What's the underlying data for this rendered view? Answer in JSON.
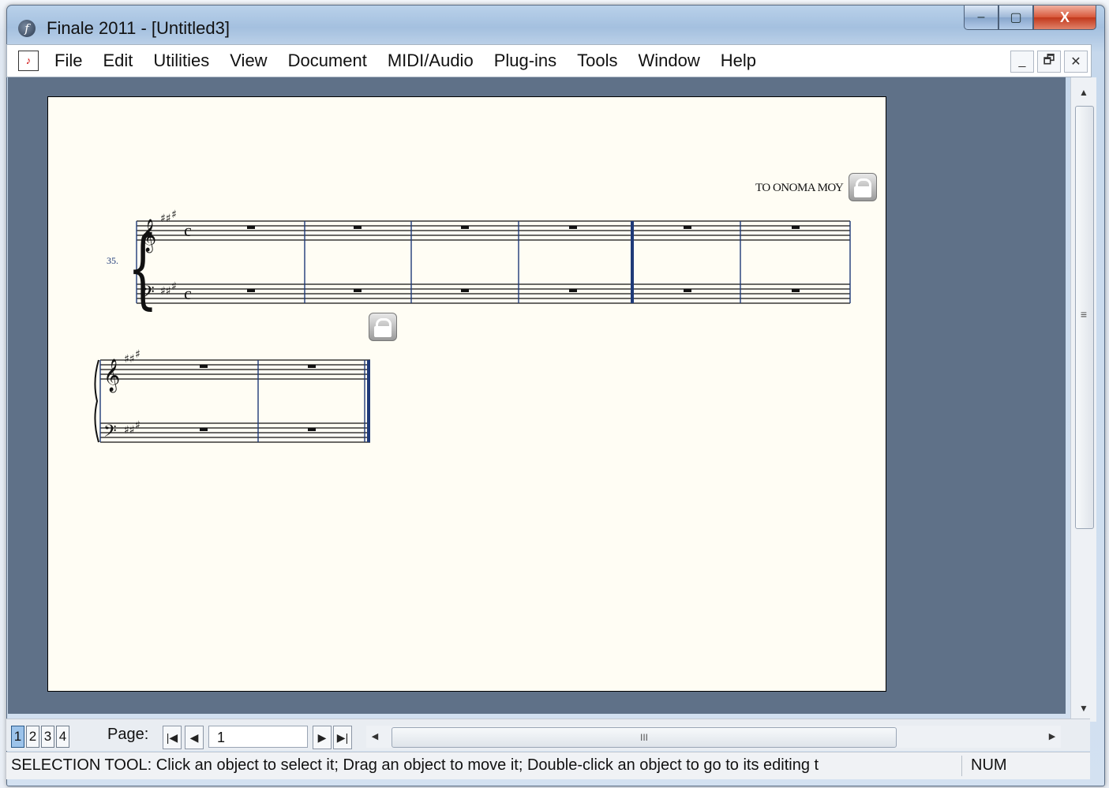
{
  "window": {
    "title": "Finale 2011 - [Untitled3]",
    "app_icon": "finale-logo-icon",
    "controls": {
      "minimize": "–",
      "maximize": "▢",
      "close": "X"
    }
  },
  "menubar": {
    "items": [
      "File",
      "Edit",
      "Utilities",
      "View",
      "Document",
      "MIDI/Audio",
      "Plug-ins",
      "Tools",
      "Window",
      "Help"
    ],
    "mdi_controls": {
      "minimize": "_",
      "restore": "🗗",
      "close": "✕"
    }
  },
  "score": {
    "title": "TO ΟΝΟΜΑ ΜΟΥ",
    "measure_number": "35.",
    "systems": [
      {
        "measures": 6,
        "time_signature": "c",
        "key_sharps": 3,
        "rest_type": "whole"
      },
      {
        "measures": 2,
        "key_sharps": 3,
        "rest_type": "whole",
        "final_barline": true
      }
    ],
    "icons": [
      "lock-icon",
      "lock-icon"
    ]
  },
  "bottom": {
    "page_buttons": [
      "1",
      "2",
      "3",
      "4"
    ],
    "active_page_button": "1",
    "page_label": "Page:",
    "page_value": "1",
    "nav_icons": [
      "first-page-icon",
      "prev-page-icon",
      "next-page-icon",
      "last-page-icon"
    ],
    "hscroll_grip": "III"
  },
  "vscroll": {
    "grip": "≡"
  },
  "status": {
    "text": "SELECTION TOOL: Click an object to select it; Drag an object to move it; Double-click an object to go to its editing t",
    "num": "NUM"
  },
  "colors": {
    "workspace": "#5f7188",
    "page": "#fffdf4",
    "barline": "#1f3a78"
  }
}
